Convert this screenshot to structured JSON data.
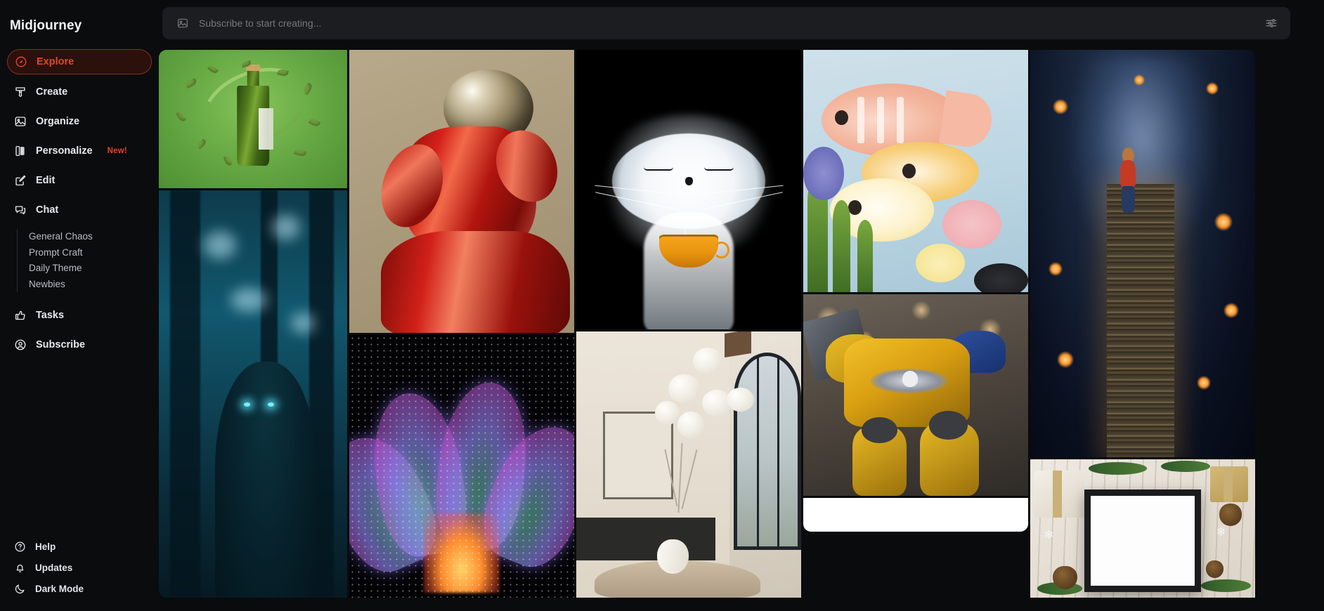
{
  "app": {
    "brand": "Midjourney"
  },
  "search": {
    "placeholder": "Subscribe to start creating...",
    "value": "",
    "image_icon": "image-icon",
    "settings_icon": "sliders-icon"
  },
  "sidebar": {
    "items": [
      {
        "label": "Explore",
        "icon": "compass-icon",
        "active": true
      },
      {
        "label": "Create",
        "icon": "brush-icon",
        "active": false
      },
      {
        "label": "Organize",
        "icon": "image-icon",
        "active": false
      },
      {
        "label": "Personalize",
        "icon": "personalize-icon",
        "active": false,
        "badge": "New!"
      },
      {
        "label": "Edit",
        "icon": "pencil-square-icon",
        "active": false
      },
      {
        "label": "Chat",
        "icon": "chat-bubble-icon",
        "active": false
      }
    ],
    "chat_channels": [
      {
        "label": "General Chaos"
      },
      {
        "label": "Prompt Craft"
      },
      {
        "label": "Daily Theme"
      },
      {
        "label": "Newbies"
      }
    ],
    "items_after_chat": [
      {
        "label": "Tasks",
        "icon": "thumbs-up-icon"
      },
      {
        "label": "Subscribe",
        "icon": "user-circle-icon"
      }
    ],
    "footer": [
      {
        "label": "Help",
        "icon": "question-circle-icon"
      },
      {
        "label": "Updates",
        "icon": "bell-icon"
      },
      {
        "label": "Dark Mode",
        "icon": "moon-icon"
      }
    ]
  },
  "colors": {
    "accent": "#e8432a",
    "accent_bg": "#2b100c",
    "accent_border": "#8a2f22",
    "sidebar_bg": "#0b0c0e",
    "page_bg": "#0a0b0d",
    "search_bg": "#1b1d21",
    "text_primary": "#e8e9ec",
    "text_muted": "#75787e"
  },
  "gallery": {
    "columns": [
      {
        "tiles": [
          {
            "name": "olive-oil-bottle-green",
            "alt": "Olive oil bottle with flying leaves on green background"
          },
          {
            "name": "dark-forest-creature",
            "alt": "Glowing-eyed creature in a teal misty forest"
          }
        ]
      },
      {
        "tiles": [
          {
            "name": "red-latex-chrome-sphere-figure",
            "alt": "Figure in red latex with a chrome sphere head"
          },
          {
            "name": "neon-iridescent-flower",
            "alt": "Glowing iridescent flower on black"
          }
        ]
      },
      {
        "tiles": [
          {
            "name": "white-fluffy-cat-with-cup",
            "alt": "Fluffy white cat holding an orange cup of coffee"
          },
          {
            "name": "modern-dining-room",
            "alt": "Modern dining room with globe chandelier and arched window"
          }
        ]
      },
      {
        "tiles": [
          {
            "name": "painted-tropical-fish",
            "alt": "Oil painting of pink and yellow tropical fish"
          },
          {
            "name": "yellow-space-marine",
            "alt": "Yellow armored space marine with gun"
          },
          {
            "name": "white-placeholder-tile",
            "alt": "White image tile"
          }
        ]
      },
      {
        "tiles": [
          {
            "name": "boy-on-book-tower-space",
            "alt": "Boy standing on a towering stack of books in space"
          },
          {
            "name": "christmas-frame-mockup",
            "alt": "Christmas frame mockup with pinecones and gifts"
          }
        ]
      }
    ]
  }
}
